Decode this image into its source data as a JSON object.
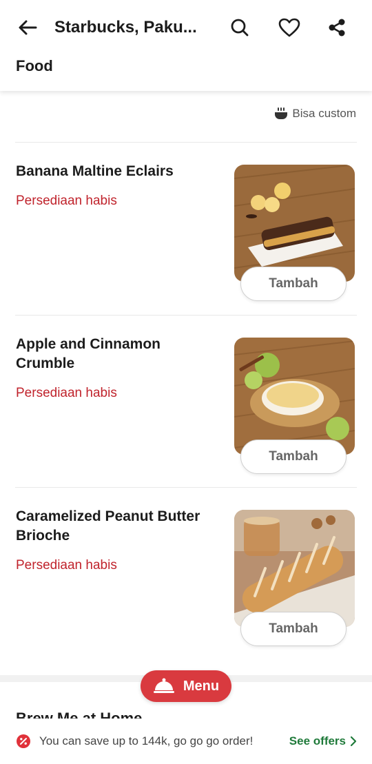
{
  "header": {
    "title": "Starbucks, Paku...",
    "section": "Food"
  },
  "custom_note": "Bisa custom",
  "items": [
    {
      "name": "Banana Maltine Eclairs",
      "status": "Persediaan habis",
      "button": "Tambah"
    },
    {
      "name": "Apple and Cinnamon Crumble",
      "status": "Persediaan habis",
      "button": "Tambah"
    },
    {
      "name": "Caramelized Peanut Butter Brioche",
      "status": "Persediaan habis",
      "button": "Tambah"
    }
  ],
  "menu_button": "Menu",
  "next_section_peek": "Brew Me at Home",
  "offer": {
    "text": "You can save up to 144k, go go go order!",
    "link": "See offers"
  },
  "colors": {
    "status_red": "#c0232c",
    "menu_red": "#d93a3f",
    "offer_green": "#1f7a3a"
  }
}
